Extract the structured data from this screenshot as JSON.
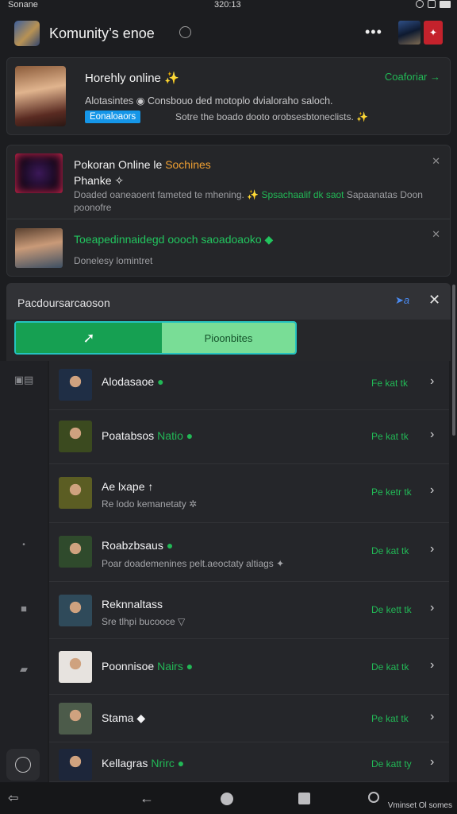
{
  "status_bar": {
    "left": "Sonane",
    "center": "320:13"
  },
  "app_bar": {
    "title": "Komunity’s enoe",
    "pic2_icon": "✦"
  },
  "featured": {
    "title": "Horehly online ✨",
    "link": "Coaforiar →",
    "desc": "Alotasintes ◉  Consbouo ded motoplo dvialoraho saloch.",
    "badge": "Eonaloaors",
    "sub": "Sotre the boado dooto orobsesbtoneclists. ✨"
  },
  "notifications": {
    "item1": {
      "title_a": "Pokoran Online le",
      "title_b": "Sochines",
      "title_c": "Phanke ✧",
      "desc_a": "Doaded oaneaoent fameted te mhening.",
      "desc_b": "✨ Spsachaalif dk saot",
      "desc_c": "Sapaanatas Doon poonofre",
      "close": "✕"
    },
    "item2": {
      "title": "Toeapedinnaidegd oooch saoadoaoko ◆",
      "desc": "Donelesy lomintret",
      "close": "✕"
    }
  },
  "panel": {
    "title": "Pacdoursarcaoson",
    "icon_text": "➤a",
    "close": "✕"
  },
  "toggle": {
    "left_label": "➚",
    "right_label": "Pioonbites"
  },
  "side_rail": {
    "top": "▣▤",
    "bullet": "•",
    "tag": "■",
    "folder": "▰"
  },
  "contacts": [
    {
      "name": "Alodasaoe",
      "tag": "●",
      "sub": "",
      "action": "Fe kat tk",
      "chevron": "›",
      "avatar": "#1f2e45"
    },
    {
      "name": "Poatabsos",
      "tag": "Natio ●",
      "sub": "",
      "action": "Pe kat tk",
      "chevron": "›",
      "avatar": "#3b4a1f"
    },
    {
      "name": "Ae lxape ↑",
      "tag": "",
      "sub": "Re lodo kemanetaty ✲",
      "action": "Pe ketr tk",
      "chevron": "›",
      "avatar": "#5b5d23"
    },
    {
      "name": "Roabzbsaus",
      "tag": "●",
      "sub": "Poar doademenines pelt.aeoctaty altiags ✦",
      "action": "De kat tk",
      "chevron": "›",
      "avatar": "#2f4a2c"
    },
    {
      "name": "Reknnaltass",
      "tag": "",
      "sub": "Sre tlhpi bucooce ▽",
      "action": "De kett tk",
      "chevron": "›",
      "avatar": "#2f4a5a"
    },
    {
      "name": "Poonnisoe",
      "tag": "Nairs ●",
      "sub": "",
      "action": "De kat tk",
      "chevron": "›",
      "avatar": "#e7e3df"
    },
    {
      "name": "Stama ◆",
      "tag": "",
      "sub": "",
      "action": "Pe kat tk",
      "chevron": "›",
      "avatar": "#4c5b4a"
    },
    {
      "name": "Kellagras",
      "tag": "Nrirc ●",
      "sub": "",
      "action": "De katt ty",
      "chevron": "›",
      "avatar": "#1d263a"
    }
  ],
  "nav_bar": {
    "left_icon": "⇦",
    "back_icon": "←",
    "watermark": "Vminset Ol somes"
  }
}
